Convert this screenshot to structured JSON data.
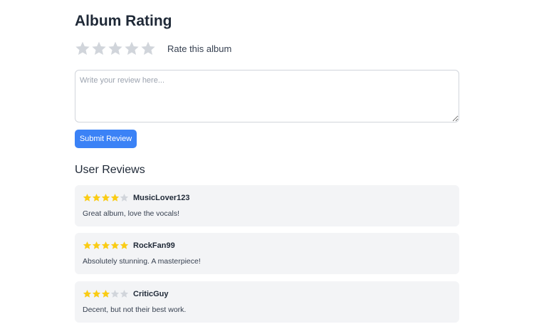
{
  "page": {
    "title": "Album Rating"
  },
  "rating": {
    "label": "Rate this album",
    "max": 5,
    "current": 0
  },
  "review_form": {
    "placeholder": "Write your review here...",
    "value": "",
    "submit_label": "Submit Review"
  },
  "reviews": {
    "heading": "User Reviews",
    "items": [
      {
        "user": "MusicLover123",
        "rating": 4,
        "text": "Great album, love the vocals!"
      },
      {
        "user": "RockFan99",
        "rating": 5,
        "text": "Absolutely stunning. A masterpiece!"
      },
      {
        "user": "CriticGuy",
        "rating": 3,
        "text": "Decent, but not their best work."
      }
    ]
  },
  "colors": {
    "star_filled": "#facc15",
    "star_empty": "#d1d5db",
    "accent": "#3b82f6",
    "card_bg": "#f3f4f6"
  },
  "icons": {
    "star": "star-icon"
  }
}
